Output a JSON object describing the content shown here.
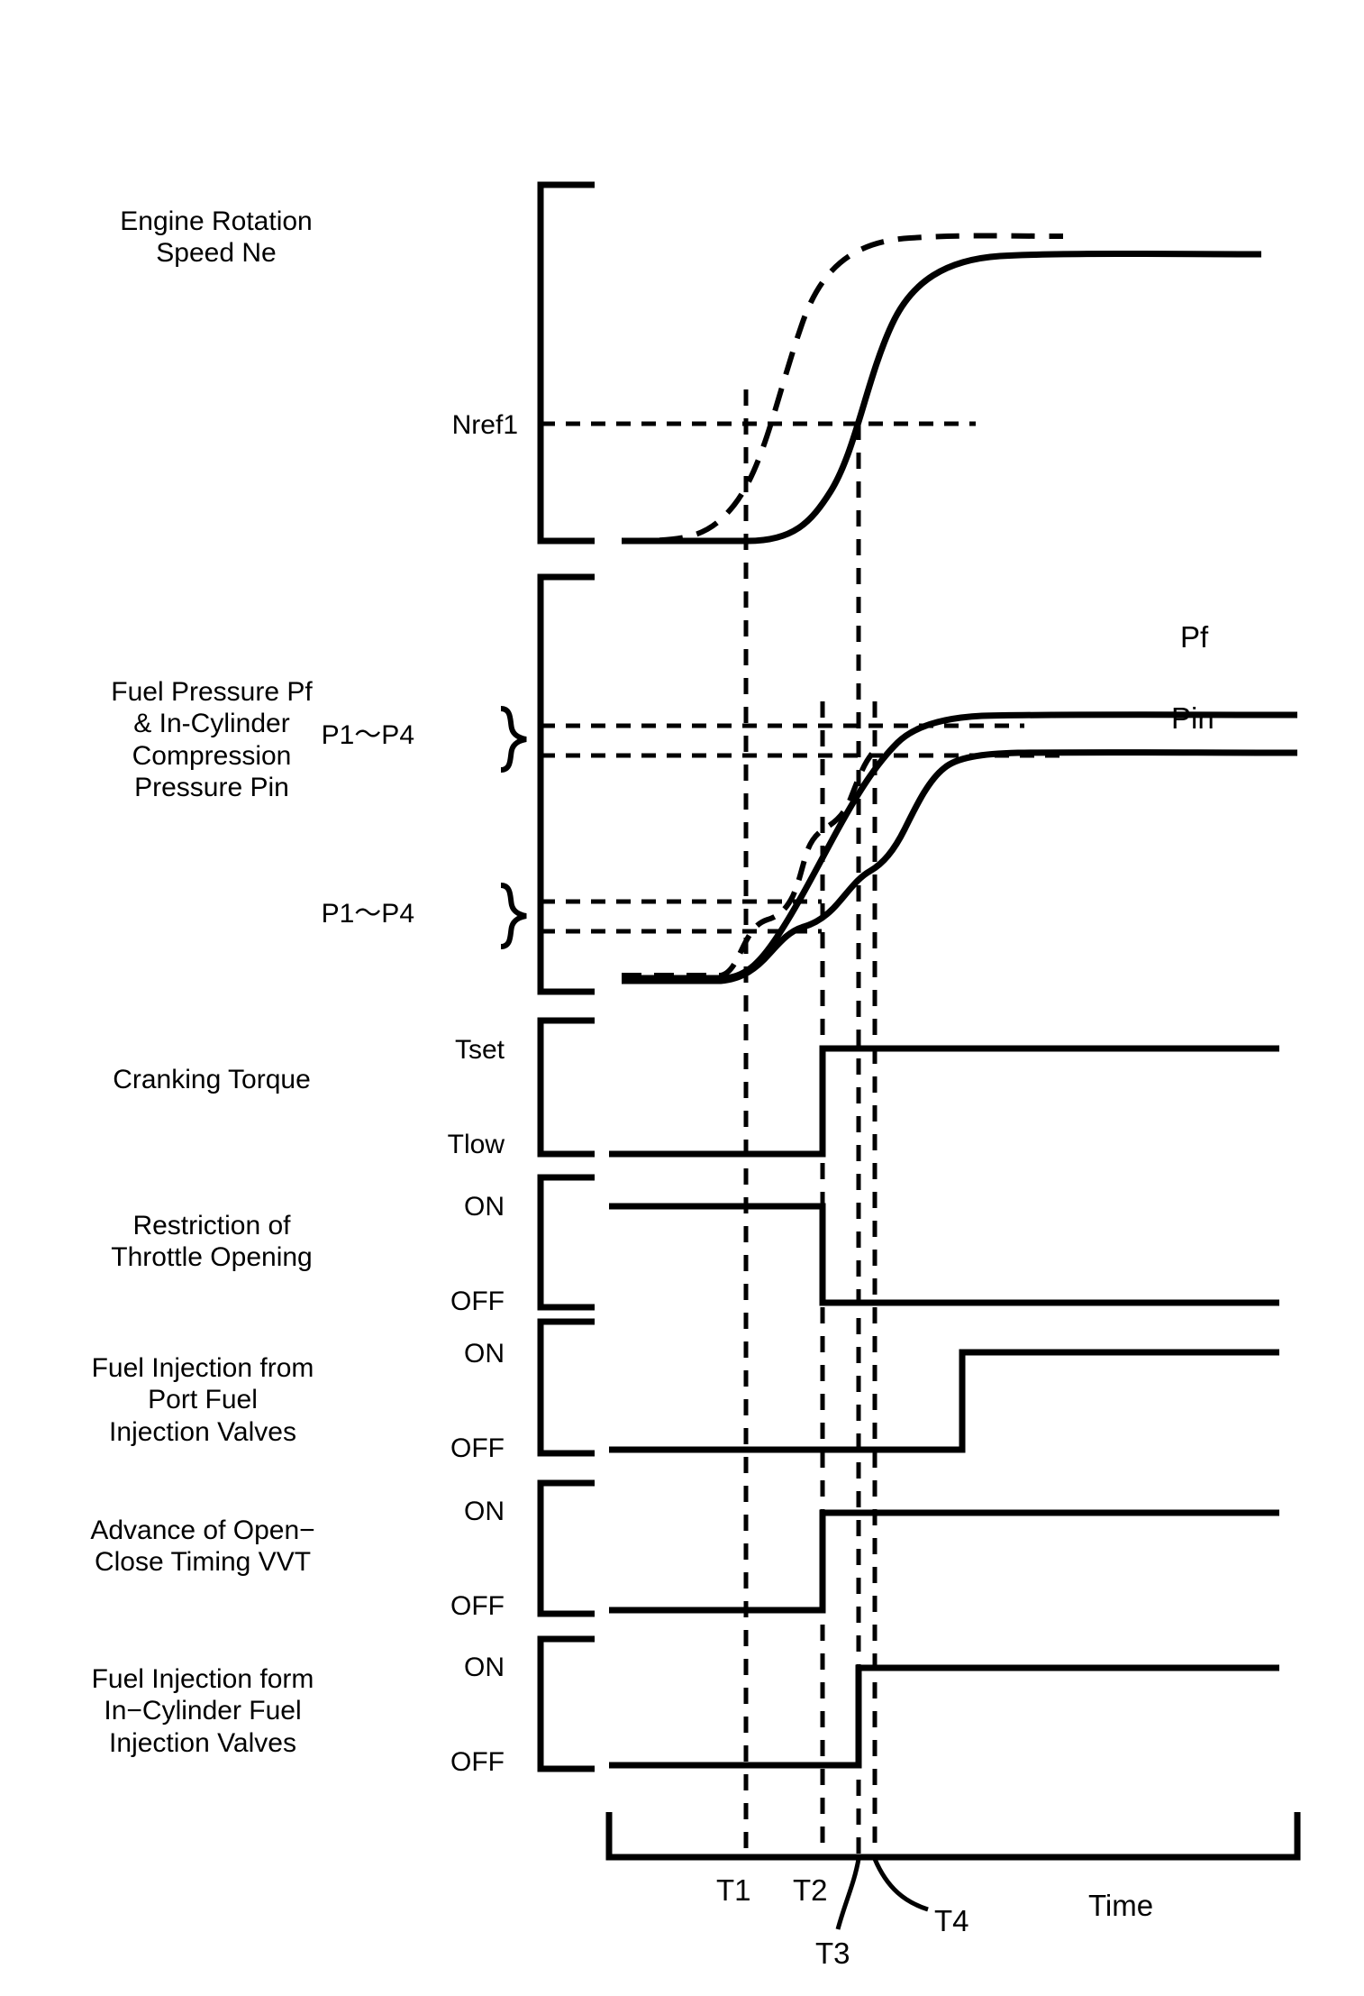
{
  "figure": {
    "type": "timing-chart",
    "background": "#ffffff",
    "ink": "#000000",
    "x_axis_label": "Time"
  },
  "time_markers": [
    {
      "id": "T1",
      "label": "T1",
      "x": 828
    },
    {
      "id": "T2",
      "label": "T2",
      "x": 913
    },
    {
      "id": "T3",
      "label": "T3",
      "x": 953
    },
    {
      "id": "T4",
      "label": "T4",
      "x": 965
    }
  ],
  "rows": [
    {
      "id": "engine-rotation-speed",
      "title_lines": [
        "Engine Rotation",
        "Speed Ne"
      ],
      "axis_labels": [
        "Nref1"
      ],
      "series": [
        {
          "name": "Ne (solid)",
          "style": "solid"
        },
        {
          "name": "Ne (dashed reference)",
          "style": "dashed"
        }
      ]
    },
    {
      "id": "fuel-pressure-and-in-cylinder-pressure",
      "title_lines": [
        "Fuel Pressure Pf",
        "& In-Cylinder",
        "Compression",
        "Pressure Pin"
      ],
      "axis_labels": [
        "P1〜P4",
        "P1〜P4"
      ],
      "curve_labels": [
        "Pf",
        "Pin"
      ],
      "series": [
        {
          "name": "Pf",
          "style": "solid"
        },
        {
          "name": "Pin",
          "style": "solid"
        },
        {
          "name": "reference",
          "style": "dashed"
        }
      ]
    },
    {
      "id": "cranking-torque",
      "title_lines": [
        "Cranking Torque"
      ],
      "axis_labels": [
        "Tset",
        "Tlow"
      ],
      "steps": [
        {
          "at": "T2",
          "from": "Tlow",
          "to": "Tset"
        }
      ]
    },
    {
      "id": "restriction-of-throttle-opening",
      "title_lines": [
        "Restriction of",
        "Throttle Opening"
      ],
      "axis_labels": [
        "ON",
        "OFF"
      ],
      "steps": [
        {
          "at": "T2",
          "from": "ON",
          "to": "OFF"
        }
      ]
    },
    {
      "id": "fuel-injection-from-port-fuel-injection-valves",
      "title_lines": [
        "Fuel Injection from",
        "Port Fuel",
        "Injection Valves"
      ],
      "axis_labels": [
        "ON",
        "OFF"
      ],
      "steps": [
        {
          "at": "T4",
          "from": "OFF",
          "to": "ON"
        }
      ]
    },
    {
      "id": "advance-of-open-close-timing-vvt",
      "title_lines": [
        "Advance of Open−",
        "Close Timing VVT"
      ],
      "axis_labels": [
        "ON",
        "OFF"
      ],
      "steps": [
        {
          "at": "T2",
          "from": "OFF",
          "to": "ON"
        }
      ]
    },
    {
      "id": "fuel-injection-from-in-cylinder-fuel-injection-valves",
      "title_lines": [
        "Fuel Injection form",
        "In−Cylinder Fuel",
        "Injection Valves"
      ],
      "axis_labels": [
        "ON",
        "OFF"
      ],
      "steps": [
        {
          "at": "T3",
          "from": "OFF",
          "to": "ON"
        }
      ]
    }
  ],
  "chart_data": {
    "type": "line",
    "title": "",
    "xlabel": "Time",
    "ylabel": "",
    "grid": false,
    "legend": "inline-annotations",
    "x_ticks": [
      "T1",
      "T2",
      "T3",
      "T4"
    ],
    "panels": [
      {
        "name": "Engine Rotation Speed Ne",
        "ylabel": "",
        "y_ticks": [
          "Nref1"
        ],
        "series": [
          {
            "name": "Ne",
            "style": "solid",
            "x": [
              "0",
              "T1",
              "0.5",
              "T3",
              "T3+",
              "end"
            ],
            "y": [
              "low",
              "low",
              "mid",
              "Nref1",
              "high",
              "high"
            ]
          },
          {
            "name": "Ne reference",
            "style": "dashed",
            "x": [
              "0",
              "T1",
              "0.45",
              "T2+",
              "end"
            ],
            "y": [
              "low",
              "low",
              "mid",
              "high",
              "high"
            ]
          }
        ],
        "annotations": [
          {
            "text": "Nref1",
            "type": "y-reference-line"
          }
        ]
      },
      {
        "name": "Fuel Pressure Pf & In-Cylinder Compression Pressure Pin",
        "ylabel": "",
        "y_ticks": [
          "P1~P4",
          "P1~P4"
        ],
        "series": [
          {
            "name": "Pf",
            "style": "solid",
            "label_at_right": "Pf",
            "y_plateau": "upper"
          },
          {
            "name": "Pin",
            "style": "solid",
            "label_at_right": "Pin",
            "y_plateau": "lower"
          },
          {
            "name": "reference",
            "style": "dashed"
          }
        ],
        "annotations": [
          {
            "text": "P1~P4",
            "type": "y-reference-pair",
            "position": "upper"
          },
          {
            "text": "P1~P4",
            "type": "y-reference-pair",
            "position": "lower"
          }
        ]
      },
      {
        "name": "Cranking Torque",
        "y_ticks": [
          "Tset",
          "Tlow"
        ],
        "series": [
          {
            "name": "Cranking Torque",
            "style": "step",
            "values": [
              {
                "x": "0",
                "y": "Tlow"
              },
              {
                "x": "T2",
                "y": "Tset"
              },
              {
                "x": "end",
                "y": "Tset"
              }
            ]
          }
        ]
      },
      {
        "name": "Restriction of Throttle Opening",
        "y_ticks": [
          "ON",
          "OFF"
        ],
        "series": [
          {
            "name": "Restriction of Throttle Opening",
            "style": "step",
            "values": [
              {
                "x": "0",
                "y": "ON"
              },
              {
                "x": "T2",
                "y": "OFF"
              },
              {
                "x": "end",
                "y": "OFF"
              }
            ]
          }
        ]
      },
      {
        "name": "Fuel Injection from Port Fuel Injection Valves",
        "y_ticks": [
          "ON",
          "OFF"
        ],
        "series": [
          {
            "name": "Port Fuel Injection",
            "style": "step",
            "values": [
              {
                "x": "0",
                "y": "OFF"
              },
              {
                "x": "T4",
                "y": "ON"
              },
              {
                "x": "end",
                "y": "ON"
              }
            ]
          }
        ]
      },
      {
        "name": "Advance of Open-Close Timing VVT",
        "y_ticks": [
          "ON",
          "OFF"
        ],
        "series": [
          {
            "name": "VVT Advance",
            "style": "step",
            "values": [
              {
                "x": "0",
                "y": "OFF"
              },
              {
                "x": "T2",
                "y": "ON"
              },
              {
                "x": "end",
                "y": "ON"
              }
            ]
          }
        ]
      },
      {
        "name": "Fuel Injection form In-Cylinder Fuel Injection Valves",
        "y_ticks": [
          "ON",
          "OFF"
        ],
        "series": [
          {
            "name": "In-Cylinder Fuel Injection",
            "style": "step",
            "values": [
              {
                "x": "0",
                "y": "OFF"
              },
              {
                "x": "T3",
                "y": "ON"
              },
              {
                "x": "end",
                "y": "ON"
              }
            ]
          }
        ]
      }
    ]
  }
}
